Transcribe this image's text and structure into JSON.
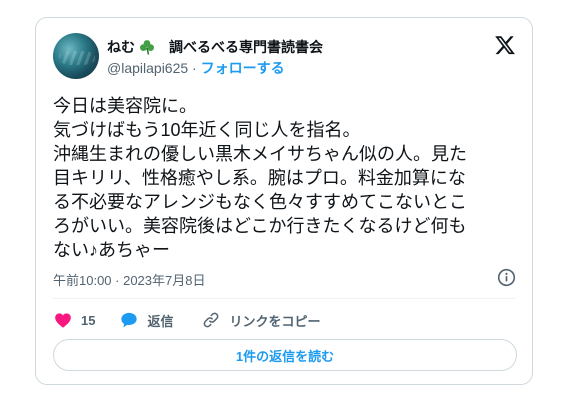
{
  "author": {
    "display_name": "ねむ",
    "group_name": "調べるべる専門書読書会",
    "handle": "@lapilapi625",
    "separator": " · ",
    "follow_label": "フォローする"
  },
  "tweet": {
    "lines": [
      "今日は美容院に。",
      "気づけばもう10年近く同じ人を指名。",
      "沖縄生まれの優しい黒木メイサちゃん似の人。見た",
      "目キリリ、性格癒やし系。腕はプロ。料金加算にな",
      "る不必要なアレンジもなく色々すすめてこないとこ",
      "ろがいい。美容院後はどこか行きたくなるけど何も",
      "ない♪あちゃー"
    ],
    "timestamp": "午前10:00 · 2023年7月8日"
  },
  "actions": {
    "like_count": "15",
    "reply_label": "返信",
    "copy_link_label": "リンクをコピー"
  },
  "replies_button_label": "1件の返信を読む",
  "colors": {
    "like": "#f91880",
    "reply": "#1d9bf0",
    "link_blue": "#1d9bf0",
    "clover_green": "#4caf50"
  },
  "icons": {
    "brand": "x-logo-icon",
    "like": "heart-icon",
    "reply": "speech-bubble-icon",
    "copy_link": "link-icon",
    "info": "info-icon",
    "emoji": "shamrock-icon"
  }
}
